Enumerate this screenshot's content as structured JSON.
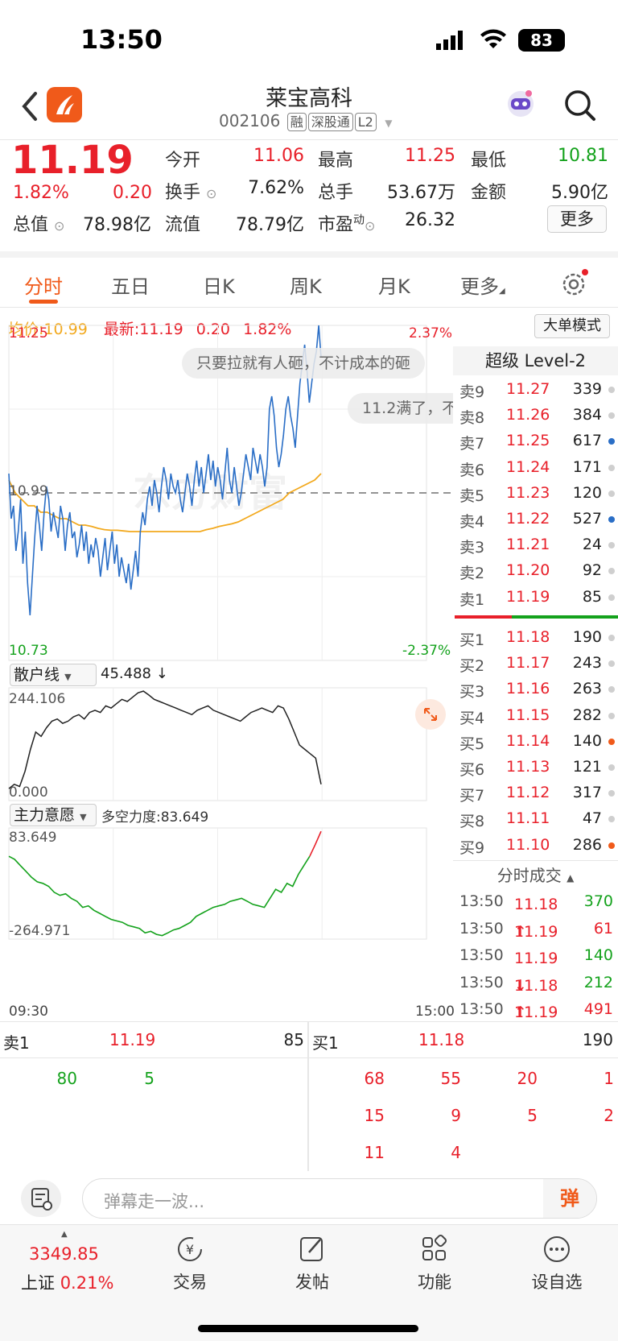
{
  "status": {
    "time": "13:50",
    "battery": "83"
  },
  "nav": {
    "title": "莱宝高科",
    "code": "002106",
    "tags": [
      "融",
      "深股通",
      "L2"
    ]
  },
  "quote": {
    "price": "11.19",
    "change_pct": "1.82%",
    "change": "0.20",
    "open_label": "今开",
    "open": "11.06",
    "high_label": "最高",
    "high": "11.25",
    "low_label": "最低",
    "low": "10.81",
    "turnover_label": "换手",
    "turnover": "7.62%",
    "volume_label": "总手",
    "volume": "53.67万",
    "amount_label": "金额",
    "amount": "5.90亿",
    "mcap_label": "总值",
    "mcap": "78.98亿",
    "float_label": "流值",
    "float": "78.79亿",
    "pe_label": "市盈",
    "pe_sup": "动",
    "pe": "26.32",
    "more_label": "更多"
  },
  "tabs": [
    "分时",
    "五日",
    "日K",
    "周K",
    "月K",
    "更多"
  ],
  "info": {
    "avg_label": "均价:",
    "avg": "10.99",
    "latest_label": "最新:",
    "latest": "11.19",
    "chg": "0.20",
    "pct": "1.82%",
    "big_order": "大单模式"
  },
  "chart_data": [
    {
      "type": "line",
      "title": "分时",
      "ylim": [
        10.73,
        11.25
      ],
      "y_labels": {
        "top": "11.25",
        "mid": "10.99",
        "bottom": "10.73",
        "top_pct": "2.37%",
        "bottom_pct": "-2.37%"
      },
      "x_labels": [
        "09:30",
        "15:00"
      ],
      "series": [
        {
          "name": "price",
          "values": [
            11.02,
            10.95,
            10.97,
            10.9,
            10.93,
            10.98,
            10.88,
            10.93,
            10.85,
            10.8,
            10.86,
            10.92,
            10.97,
            10.94,
            10.9,
            10.96,
            11.0,
            10.98,
            10.93,
            10.96,
            10.94,
            10.92,
            10.97,
            10.95,
            10.9,
            10.94,
            10.96,
            10.92,
            10.93,
            10.89,
            10.91,
            10.94,
            10.9,
            10.93,
            10.88,
            10.91,
            10.89,
            10.92,
            10.9,
            10.86,
            10.89,
            10.92,
            10.87,
            10.9,
            10.93,
            10.88,
            10.91,
            10.86,
            10.89,
            10.87,
            10.85,
            10.88,
            10.84,
            10.87,
            10.9,
            10.86,
            10.93,
            10.96,
            10.94,
            10.98,
            11.0,
            10.97,
            11.01,
            10.99,
            10.96,
            11.0,
            11.03,
            11.01,
            10.98,
            11.02,
            11.0,
            10.99,
            11.01,
            10.98,
            10.96,
            10.99,
            11.02,
            11.0,
            10.97,
            11.01,
            11.04,
            11.0,
            11.03,
            10.99,
            11.02,
            11.05,
            11.01,
            11.04,
            11.0,
            11.03,
            11.01,
            10.98,
            11.02,
            11.06,
            11.01,
            10.99,
            11.03,
            11.0,
            10.97,
            10.99,
            11.02,
            11.05,
            11.03,
            11.01,
            11.06,
            11.04,
            11.02,
            11.05,
            11.03,
            11.0,
            11.03,
            11.12,
            11.14,
            11.11,
            11.06,
            11.03,
            11.05,
            11.08,
            11.12,
            11.14,
            11.11,
            11.09,
            11.06,
            11.11,
            11.16,
            11.19,
            11.22,
            11.18,
            11.13,
            11.16,
            11.19,
            11.21,
            11.25,
            11.2
          ]
        },
        {
          "name": "avg",
          "values": [
            11.01,
            10.99,
            10.98,
            10.97,
            10.97,
            10.96,
            10.96,
            10.955,
            10.95,
            10.95,
            10.945,
            10.94,
            10.94,
            10.938,
            10.935,
            10.933,
            10.932,
            10.932,
            10.931,
            10.93,
            10.93,
            10.93,
            10.93,
            10.93,
            10.93,
            10.93,
            10.93,
            10.93,
            10.93,
            10.93,
            10.93,
            10.933,
            10.935,
            10.938,
            10.94,
            10.942,
            10.945,
            10.95,
            10.955,
            10.96,
            10.965,
            10.97,
            10.975,
            10.98,
            10.99,
            10.995,
            11.0,
            11.005,
            11.01,
            11.02
          ]
        }
      ]
    },
    {
      "type": "line",
      "title": "散户线",
      "value_label": "45.488",
      "ylim": [
        0.0,
        244.106
      ],
      "y_labels": {
        "top": "244.106",
        "bottom": "0.000"
      },
      "series": [
        {
          "name": "散户线",
          "values": [
            20,
            30,
            25,
            60,
            110,
            150,
            140,
            160,
            175,
            180,
            170,
            175,
            185,
            190,
            180,
            195,
            200,
            195,
            210,
            205,
            215,
            225,
            220,
            230,
            240,
            244,
            235,
            225,
            220,
            215,
            210,
            205,
            200,
            195,
            190,
            200,
            205,
            210,
            200,
            195,
            190,
            185,
            180,
            175,
            185,
            195,
            200,
            205,
            200,
            195,
            210,
            205,
            180,
            150,
            120,
            110,
            100,
            90,
            30
          ]
        }
      ]
    },
    {
      "type": "line",
      "title": "主力意愿",
      "value_label": "多空力度:83.649",
      "ylim": [
        -264.971,
        83.649
      ],
      "y_labels": {
        "top": "83.649",
        "bottom": "-264.971"
      },
      "series": [
        {
          "name": "主力意愿",
          "values": [
            0,
            -10,
            -30,
            -50,
            -70,
            -85,
            -90,
            -100,
            -120,
            -130,
            -125,
            -140,
            -150,
            -170,
            -165,
            -180,
            -190,
            -200,
            -210,
            -215,
            -220,
            -230,
            -235,
            -240,
            -255,
            -250,
            -260,
            -264,
            -255,
            -245,
            -240,
            -230,
            -220,
            -200,
            -190,
            -180,
            -170,
            -165,
            -160,
            -150,
            -145,
            -140,
            -150,
            -160,
            -165,
            -170,
            -140,
            -110,
            -120,
            -90,
            -100,
            -60,
            -30,
            0,
            40,
            83
          ]
        }
      ]
    }
  ],
  "orderbook": {
    "header": "超级 Level-2",
    "asks": [
      {
        "label": "卖9",
        "price": "11.27",
        "vol": "339",
        "dot": "gray"
      },
      {
        "label": "卖8",
        "price": "11.26",
        "vol": "384",
        "dot": "gray"
      },
      {
        "label": "卖7",
        "price": "11.25",
        "vol": "617",
        "dot": "blue"
      },
      {
        "label": "卖6",
        "price": "11.24",
        "vol": "171",
        "dot": "gray"
      },
      {
        "label": "卖5",
        "price": "11.23",
        "vol": "120",
        "dot": "gray"
      },
      {
        "label": "卖4",
        "price": "11.22",
        "vol": "527",
        "dot": "blue"
      },
      {
        "label": "卖3",
        "price": "11.21",
        "vol": "24",
        "dot": "gray"
      },
      {
        "label": "卖2",
        "price": "11.20",
        "vol": "92",
        "dot": "gray"
      },
      {
        "label": "卖1",
        "price": "11.19",
        "vol": "85",
        "dot": "gray"
      }
    ],
    "bids": [
      {
        "label": "买1",
        "price": "11.18",
        "vol": "190",
        "dot": "gray"
      },
      {
        "label": "买2",
        "price": "11.17",
        "vol": "243",
        "dot": "gray"
      },
      {
        "label": "买3",
        "price": "11.16",
        "vol": "263",
        "dot": "gray"
      },
      {
        "label": "买4",
        "price": "11.15",
        "vol": "282",
        "dot": "gray"
      },
      {
        "label": "买5",
        "price": "11.14",
        "vol": "140",
        "dot": "orange"
      },
      {
        "label": "买6",
        "price": "11.13",
        "vol": "121",
        "dot": "gray"
      },
      {
        "label": "买7",
        "price": "11.12",
        "vol": "317",
        "dot": "gray"
      },
      {
        "label": "买8",
        "price": "11.11",
        "vol": "47",
        "dot": "gray"
      },
      {
        "label": "买9",
        "price": "11.10",
        "vol": "286",
        "dot": "orange"
      }
    ],
    "ticks_header": "分时成交",
    "ticks": [
      {
        "time": "13:50",
        "price": "11.18",
        "arrow": "",
        "vol": "370",
        "color": "green"
      },
      {
        "time": "13:50",
        "price": "11.19",
        "arrow": "↑",
        "vol": "61",
        "color": "red"
      },
      {
        "time": "13:50",
        "price": "11.19",
        "arrow": "",
        "vol": "140",
        "color": "green"
      },
      {
        "time": "13:50",
        "price": "11.18",
        "arrow": "↓",
        "vol": "212",
        "color": "green"
      },
      {
        "time": "13:50",
        "price": "11.19",
        "arrow": "↑",
        "vol": "491",
        "color": "red"
      }
    ]
  },
  "danmaku": [
    "只要拉就有人砸，不计成本的砸",
    "11.2满了，不"
  ],
  "queues": {
    "sell_label": "卖1",
    "sell_price": "11.19",
    "sell_vol": "85",
    "buy_label": "买1",
    "buy_price": "11.18",
    "buy_vol": "190",
    "sell_orders": [
      "80",
      "5"
    ],
    "buy_orders": [
      "68",
      "55",
      "20",
      "1",
      "15",
      "9",
      "5",
      "2",
      "11",
      "4"
    ]
  },
  "danmu_input": {
    "placeholder": "弹幕走一波...",
    "send": "弹"
  },
  "tabbar": {
    "index_value": "3349.85",
    "index_name": "上证",
    "index_pct": "0.21%",
    "items": [
      "交易",
      "发帖",
      "功能",
      "设自选"
    ]
  },
  "colors": {
    "red": "#e8202a",
    "green": "#14a21c",
    "accent": "#f05a1a",
    "blue": "#2a6ec6",
    "avg": "#f2a91e"
  }
}
